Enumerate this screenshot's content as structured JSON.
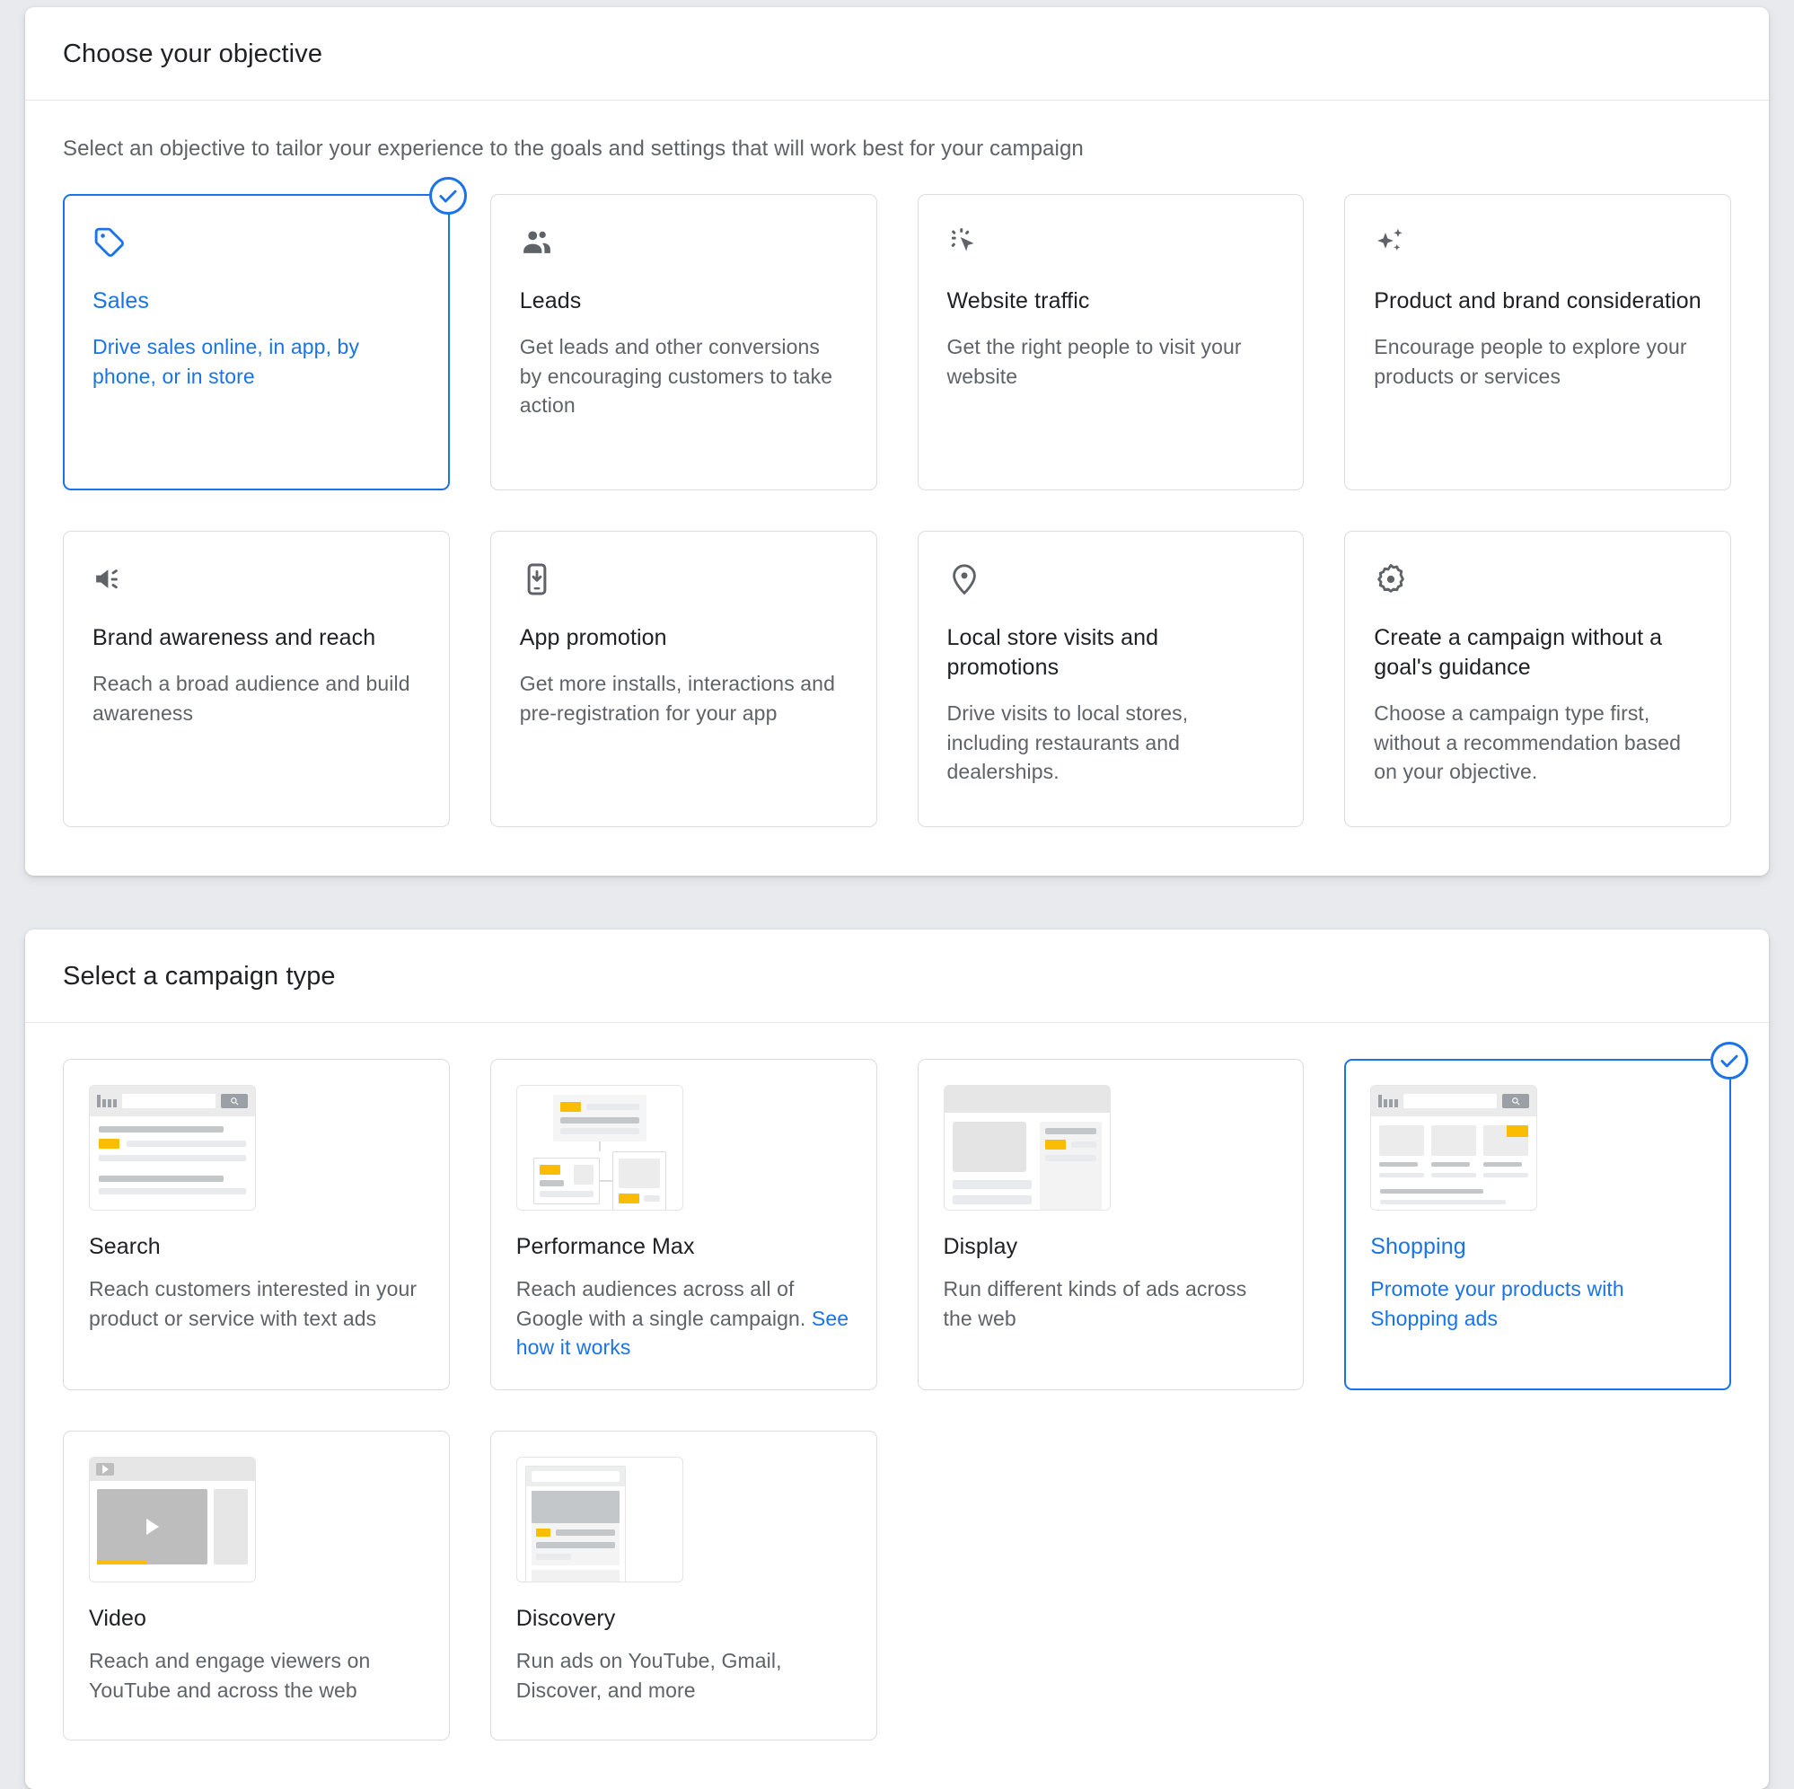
{
  "objective_section": {
    "title": "Choose your objective",
    "subtitle": "Select an objective to tailor your experience to the goals and settings that will work best for your campaign",
    "selected_index": 0,
    "accent_color": "#1a73e8",
    "cards": [
      {
        "icon": "sales-tag-icon",
        "title": "Sales",
        "description": "Drive sales online, in app, by phone, or in store",
        "selected": true
      },
      {
        "icon": "leads-people-icon",
        "title": "Leads",
        "description": "Get leads and other conversions by encouraging customers to take action",
        "selected": false
      },
      {
        "icon": "website-traffic-cursor-icon",
        "title": "Website traffic",
        "description": "Get the right people to visit your website",
        "selected": false
      },
      {
        "icon": "product-brand-sparkle-icon",
        "title": "Product and brand consideration",
        "description": "Encourage people to explore your products or services",
        "selected": false
      },
      {
        "icon": "brand-awareness-speaker-icon",
        "title": "Brand awareness and reach",
        "description": "Reach a broad audience and build awareness",
        "selected": false
      },
      {
        "icon": "app-promotion-phone-icon",
        "title": "App promotion",
        "description": "Get more installs, interactions and pre-registration for your app",
        "selected": false
      },
      {
        "icon": "local-store-pin-icon",
        "title": "Local store visits and promotions",
        "description": "Drive visits to local stores, including restaurants and dealerships.",
        "selected": false
      },
      {
        "icon": "no-goal-gear-icon",
        "title": "Create a campaign without a goal's guidance",
        "description": "Choose a campaign type first, without a recommendation based on your objective.",
        "selected": false
      }
    ]
  },
  "campaign_type_section": {
    "title": "Select a campaign type",
    "selected_index": 3,
    "cards": [
      {
        "thumb": "search-results-thumb",
        "title": "Search",
        "description": "Reach customers interested in your product or service with text ads",
        "link_text": "",
        "selected": false
      },
      {
        "thumb": "performance-max-network-thumb",
        "title": "Performance Max",
        "description": "Reach audiences across all of Google with a single campaign. ",
        "link_text": "See how it works",
        "selected": false
      },
      {
        "thumb": "display-webpage-thumb",
        "title": "Display",
        "description": "Run different kinds of ads across the web",
        "link_text": "",
        "selected": false
      },
      {
        "thumb": "shopping-products-thumb",
        "title": "Shopping",
        "description": "Promote your products with Shopping ads",
        "link_text": "",
        "selected": true
      },
      {
        "thumb": "video-player-thumb",
        "title": "Video",
        "description": "Reach and engage viewers on YouTube and across the web",
        "link_text": "",
        "selected": false
      },
      {
        "thumb": "discovery-feed-thumb",
        "title": "Discovery",
        "description": "Run ads on YouTube, Gmail, Discover, and more",
        "link_text": "",
        "selected": false
      }
    ]
  }
}
